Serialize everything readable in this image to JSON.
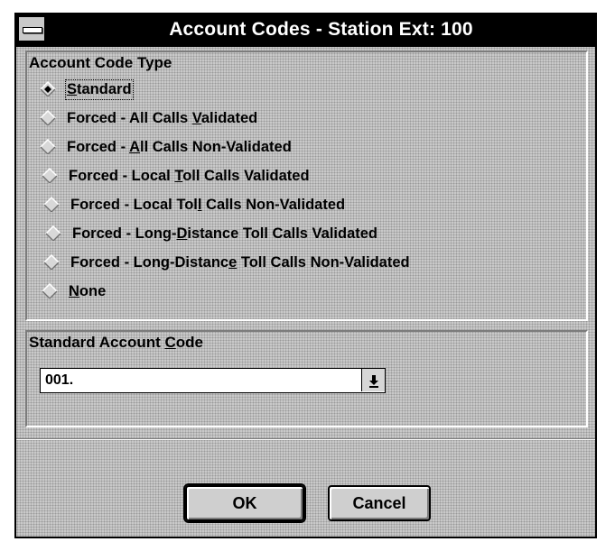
{
  "window": {
    "title": "Account Codes - Station Ext:  100"
  },
  "account_code_type": {
    "legend": "Account Code Type",
    "selected_index": 0,
    "options": [
      {
        "pre": "",
        "mn": "S",
        "post": "tandard"
      },
      {
        "pre": "Forced - All Calls ",
        "mn": "V",
        "post": "alidated"
      },
      {
        "pre": "Forced - ",
        "mn": "A",
        "post": "ll Calls Non-Validated"
      },
      {
        "pre": "Forced - Local ",
        "mn": "T",
        "post": "oll Calls Validated"
      },
      {
        "pre": "Forced - Local Tol",
        "mn": "l",
        "post": " Calls Non-Validated"
      },
      {
        "pre": "Forced - Long-",
        "mn": "D",
        "post": "istance Toll Calls Validated"
      },
      {
        "pre": "Forced - Long-Distanc",
        "mn": "e",
        "post": " Toll Calls Non-Validated"
      },
      {
        "pre": "",
        "mn": "N",
        "post": "one"
      }
    ]
  },
  "standard_account_code": {
    "legend_pre": "Standard Account ",
    "legend_mn": "C",
    "legend_post": "ode",
    "value": "001."
  },
  "buttons": {
    "ok_label": "OK",
    "cancel_label": "Cancel"
  }
}
